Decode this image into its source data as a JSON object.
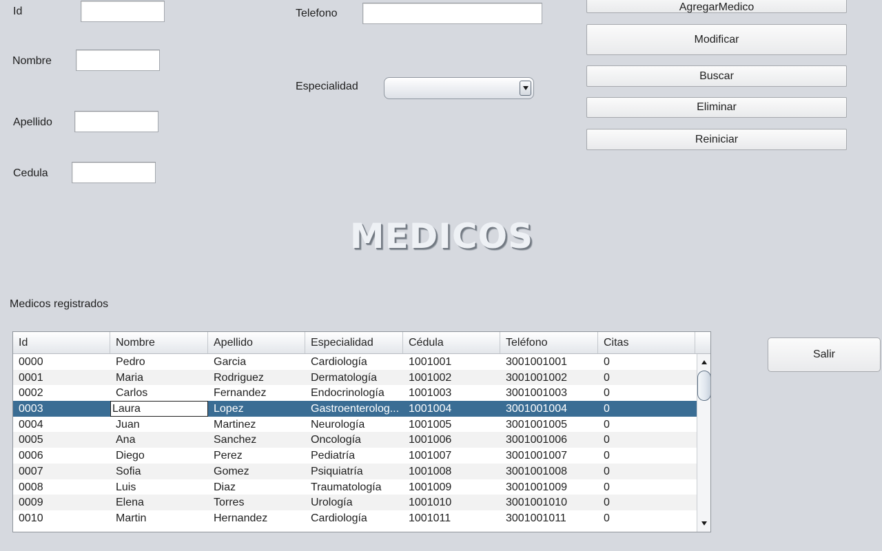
{
  "form": {
    "id_label": "Id",
    "id_value": "",
    "nombre_label": "Nombre",
    "nombre_value": "",
    "apellido_label": "Apellido",
    "apellido_value": "",
    "cedula_label": "Cedula",
    "cedula_value": "",
    "telefono_label": "Telefono",
    "telefono_value": "",
    "especialidad_label": "Especialidad",
    "especialidad_value": ""
  },
  "buttons": {
    "agregar": "AgregarMedico",
    "modificar": "Modificar",
    "buscar": "Buscar",
    "eliminar": "Eliminar",
    "reiniciar": "Reiniciar",
    "salir": "Salir"
  },
  "title": "MEDICOS",
  "table": {
    "caption": "Medicos registrados",
    "columns": [
      "Id",
      "Nombre",
      "Apellido",
      "Especialidad",
      "Cédula",
      "Teléfono",
      "Citas"
    ],
    "selected_row": 3,
    "rows": [
      [
        "0000",
        "Pedro",
        "Garcia",
        "Cardiología",
        "1001001",
        "3001001001",
        "0"
      ],
      [
        "0001",
        "Maria",
        "Rodriguez",
        "Dermatología",
        "1001002",
        "3001001002",
        "0"
      ],
      [
        "0002",
        "Carlos",
        "Fernandez",
        "Endocrinología",
        "1001003",
        "3001001003",
        "0"
      ],
      [
        "0003",
        "Laura",
        "Lopez",
        "Gastroenterolog...",
        "1001004",
        "3001001004",
        "0"
      ],
      [
        "0004",
        "Juan",
        "Martinez",
        "Neurología",
        "1001005",
        "3001001005",
        "0"
      ],
      [
        "0005",
        "Ana",
        "Sanchez",
        "Oncología",
        "1001006",
        "3001001006",
        "0"
      ],
      [
        "0006",
        "Diego",
        "Perez",
        "Pediatría",
        "1001007",
        "3001001007",
        "0"
      ],
      [
        "0007",
        "Sofia",
        "Gomez",
        "Psiquiatría",
        "1001008",
        "3001001008",
        "0"
      ],
      [
        "0008",
        "Luis",
        "Diaz",
        "Traumatología",
        "1001009",
        "3001001009",
        "0"
      ],
      [
        "0009",
        "Elena",
        "Torres",
        "Urología",
        "1001010",
        "3001001010",
        "0"
      ],
      [
        "0010",
        "Martin",
        "Hernandez",
        "Cardiología",
        "1001011",
        "3001001011",
        "0"
      ]
    ]
  },
  "colors": {
    "background": "#d6d9df",
    "selection": "#3a6d94"
  },
  "icons": {
    "combo_arrow": "chevron-down-icon",
    "scroll_up": "arrow-up-icon",
    "scroll_down": "arrow-down-icon"
  }
}
